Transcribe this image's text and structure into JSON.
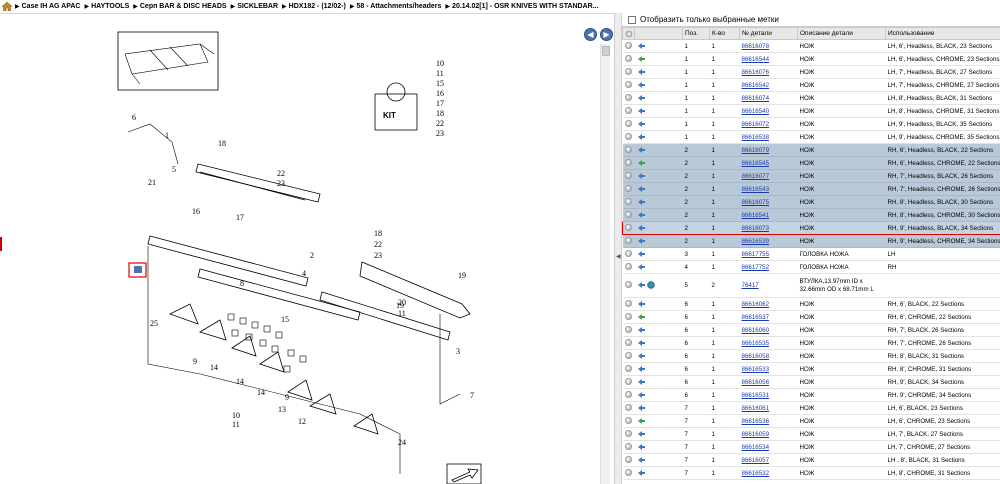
{
  "breadcrumb": [
    "Case IH AG APAC",
    "HAYTOOLS",
    "Серп BAR & DISC HEADS",
    "SICKLEBAR",
    "HDX182 - (12/02-)",
    "58 - Attachments/headers",
    "20.14.02[1] - OSR KNIVES WITH STANDAR..."
  ],
  "nav": {
    "back": "◀",
    "forward": "▶"
  },
  "filter_label": "Отобразить только выбранные метки",
  "columns": {
    "pos": "Поз.",
    "qty": "К-во",
    "partno": "№ детали",
    "desc": "Описание детали",
    "usage": "Использование"
  },
  "rows": [
    {
      "pos": "1",
      "qty": "1",
      "partno": "86616078",
      "desc": "НОЖ",
      "usage": "LH, 6', Headless, BLACK, 23 Sections",
      "icon": "blue",
      "hl": "none"
    },
    {
      "pos": "1",
      "qty": "1",
      "partno": "86616544",
      "desc": "НОЖ",
      "usage": "LH, 6', Headless, CHROME, 23 Sections",
      "icon": "green",
      "hl": "none"
    },
    {
      "pos": "1",
      "qty": "1",
      "partno": "86616076",
      "desc": "НОЖ",
      "usage": "LH, 7', Headless, BLACK, 27 Sections",
      "icon": "blue",
      "hl": "none"
    },
    {
      "pos": "1",
      "qty": "1",
      "partno": "86616542",
      "desc": "НОЖ",
      "usage": "LH, 7', Headless, CHROME, 27 Sections",
      "icon": "blue",
      "hl": "none"
    },
    {
      "pos": "1",
      "qty": "1",
      "partno": "86616074",
      "desc": "НОЖ",
      "usage": "LH, 8', Headless, BLACK, 31 Sections",
      "icon": "blue",
      "hl": "none"
    },
    {
      "pos": "1",
      "qty": "1",
      "partno": "86616540",
      "desc": "НОЖ",
      "usage": "LH, 8', Headless, CHROME, 31 Sections",
      "icon": "blue",
      "hl": "none"
    },
    {
      "pos": "1",
      "qty": "1",
      "partno": "86616072",
      "desc": "НОЖ",
      "usage": "LH, 9', Headless, BLACK, 35 Sections",
      "icon": "blue",
      "hl": "none"
    },
    {
      "pos": "1",
      "qty": "1",
      "partno": "86616538",
      "desc": "НОЖ",
      "usage": "LH, 9', Headless, CHROME, 35 Sections",
      "icon": "blue",
      "hl": "none"
    },
    {
      "pos": "2",
      "qty": "1",
      "partno": "86616079",
      "desc": "НОЖ",
      "usage": "RH, 6', Headless, BLACK, 22 Sections",
      "icon": "blue",
      "hl": "grp"
    },
    {
      "pos": "2",
      "qty": "1",
      "partno": "86616545",
      "desc": "НОЖ",
      "usage": "RH, 6', Headless, CHROME, 22 Sections",
      "icon": "green",
      "hl": "grp"
    },
    {
      "pos": "2",
      "qty": "1",
      "partno": "86616077",
      "desc": "НОЖ",
      "usage": "RH, 7', Headless, BLACK, 26 Sections",
      "icon": "blue",
      "hl": "grp"
    },
    {
      "pos": "2",
      "qty": "1",
      "partno": "86616543",
      "desc": "НОЖ",
      "usage": "RH, 7', Headless, CHROME, 26 Sections",
      "icon": "blue",
      "hl": "grp"
    },
    {
      "pos": "2",
      "qty": "1",
      "partno": "86616075",
      "desc": "НОЖ",
      "usage": "RH, 8', Headless, BLACK, 30 Sections",
      "icon": "blue",
      "hl": "grp"
    },
    {
      "pos": "2",
      "qty": "1",
      "partno": "86616541",
      "desc": "НОЖ",
      "usage": "RH, 8', Headless, CHROME, 30 Sections",
      "icon": "blue",
      "hl": "grp"
    },
    {
      "pos": "2",
      "qty": "1",
      "partno": "86616073",
      "desc": "НОЖ",
      "usage": "RH, 9', Headless, BLACK, 34 Sections",
      "icon": "blue",
      "hl": "sel"
    },
    {
      "pos": "2",
      "qty": "1",
      "partno": "86616539",
      "desc": "НОЖ",
      "usage": "RH, 9', Headless, CHROME, 34 Sections",
      "icon": "blue",
      "hl": "grp"
    },
    {
      "pos": "3",
      "qty": "1",
      "partno": "86617755",
      "desc": "ГОЛОВКА НОЖА",
      "usage": "LH",
      "icon": "blue",
      "hl": "none"
    },
    {
      "pos": "4",
      "qty": "1",
      "partno": "86617752",
      "desc": "ГОЛОВКА НОЖА",
      "usage": "RH",
      "icon": "blue",
      "hl": "none"
    },
    {
      "pos": "5",
      "qty": "2",
      "partno": "76417",
      "desc": "ВТУЛКА,13.97mm ID x 32.66mm OD x 68.71mm L",
      "usage": "",
      "icon": "globe",
      "hl": "none",
      "tall": true
    },
    {
      "pos": "6",
      "qty": "1",
      "partno": "86616062",
      "desc": "НОЖ",
      "usage": "RH, 6', BLACK, 22 Sections",
      "icon": "blue",
      "hl": "none"
    },
    {
      "pos": "6",
      "qty": "1",
      "partno": "86616537",
      "desc": "НОЖ",
      "usage": "RH, 6', CHROME, 22 Sections",
      "icon": "green",
      "hl": "none"
    },
    {
      "pos": "6",
      "qty": "1",
      "partno": "86616060",
      "desc": "НОЖ",
      "usage": "RH, 7', BLACK, 26 Sections",
      "icon": "blue",
      "hl": "none"
    },
    {
      "pos": "6",
      "qty": "1",
      "partno": "86616535",
      "desc": "НОЖ",
      "usage": "RH, 7', CHROME, 26 Sections",
      "icon": "blue",
      "hl": "none"
    },
    {
      "pos": "6",
      "qty": "1",
      "partno": "86616058",
      "desc": "НОЖ",
      "usage": "RH, 8', BLACK, 31 Sections",
      "icon": "blue",
      "hl": "none"
    },
    {
      "pos": "6",
      "qty": "1",
      "partno": "86616533",
      "desc": "НОЖ",
      "usage": "RH, 8', CHROME, 31 Sections",
      "icon": "blue",
      "hl": "none"
    },
    {
      "pos": "6",
      "qty": "1",
      "partno": "86616056",
      "desc": "НОЖ",
      "usage": "RH, 9', BLACK, 34 Sections",
      "icon": "blue",
      "hl": "none"
    },
    {
      "pos": "6",
      "qty": "1",
      "partno": "86616531",
      "desc": "НОЖ",
      "usage": "RH, 9', CHROME, 34 Sections",
      "icon": "blue",
      "hl": "none"
    },
    {
      "pos": "7",
      "qty": "1",
      "partno": "86616061",
      "desc": "НОЖ",
      "usage": "LH, 6', BLACK, 23 Sections",
      "icon": "blue",
      "hl": "none"
    },
    {
      "pos": "7",
      "qty": "1",
      "partno": "86616536",
      "desc": "НОЖ",
      "usage": "LH, 6', CHROME, 23 Sections",
      "icon": "green",
      "hl": "none"
    },
    {
      "pos": "7",
      "qty": "1",
      "partno": "86616059",
      "desc": "НОЖ",
      "usage": "LH, 7', BLACK, 27 Sections",
      "icon": "blue",
      "hl": "none"
    },
    {
      "pos": "7",
      "qty": "1",
      "partno": "86616534",
      "desc": "НОЖ",
      "usage": "LH, 7', CHROME, 27 Sections",
      "icon": "blue",
      "hl": "none"
    },
    {
      "pos": "7",
      "qty": "1",
      "partno": "86616057",
      "desc": "НОЖ",
      "usage": "LH , 8', BLACK, 31 Sections",
      "icon": "blue",
      "hl": "none"
    },
    {
      "pos": "7",
      "qty": "1",
      "partno": "86616532",
      "desc": "НОЖ",
      "usage": "LH, 8', CHROME, 31 Sections",
      "icon": "blue",
      "hl": "none"
    }
  ],
  "diagram": {
    "kit_label": "KIT",
    "kit_refs": [
      "10",
      "11",
      "15",
      "16",
      "17",
      "18",
      "22",
      "23"
    ],
    "callouts": [
      "1",
      "2",
      "3",
      "5",
      "6",
      "7",
      "8",
      "9",
      "9",
      "10",
      "11",
      "12",
      "13",
      "14",
      "14",
      "14",
      "15",
      "16",
      "17",
      "18",
      "19",
      "19",
      "20",
      "21",
      "22",
      "23",
      "18",
      "22",
      "23",
      "25",
      "24",
      "4",
      "11"
    ]
  },
  "colors": {
    "accent": "#4d73b0",
    "selection_border": "#dd0000",
    "group_row": "#b9c9d8",
    "link": "#1a3bb0"
  }
}
